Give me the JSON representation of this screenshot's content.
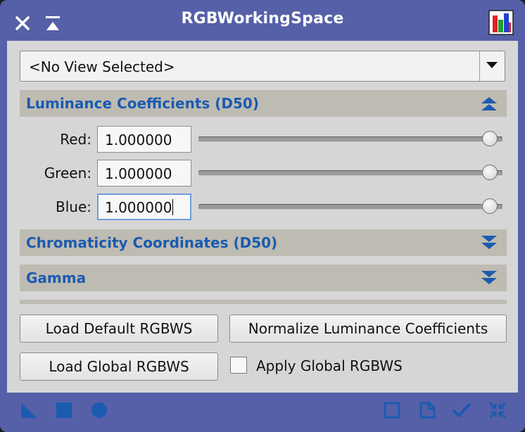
{
  "window": {
    "title": "RGBWorkingSpace"
  },
  "view_selector": {
    "value": "<No View Selected>"
  },
  "sections": {
    "luminance": {
      "title": "Luminance Coefficients (D50)",
      "expanded": true
    },
    "chromaticity": {
      "title": "Chromaticity Coordinates (D50)",
      "expanded": false
    },
    "gamma": {
      "title": "Gamma",
      "expanded": false
    }
  },
  "luminance": {
    "rows": [
      {
        "label": "Red:",
        "value": "1.000000",
        "slider": 1.0
      },
      {
        "label": "Green:",
        "value": "1.000000",
        "slider": 1.0
      },
      {
        "label": "Blue:",
        "value": "1.000000",
        "slider": 1.0
      }
    ]
  },
  "buttons": {
    "load_default": "Load Default RGBWS",
    "normalize": "Normalize Luminance Coefficients",
    "load_global": "Load Global RGBWS"
  },
  "apply_global": {
    "label": "Apply Global RGBWS",
    "checked": false
  },
  "icons": {
    "titlebar": [
      "close-icon",
      "shade-icon",
      "app-icon"
    ],
    "bottom_left": [
      "new-instance-icon",
      "apply-global-icon",
      "apply-icon"
    ],
    "bottom_right": [
      "browse-documentation-icon",
      "edit-instance-icon",
      "apply-check-icon",
      "reset-icon"
    ]
  },
  "colors": {
    "accent": "#1a5bb0",
    "frame": "#5560a8",
    "panel": "#d6d6d6",
    "section": "#bebbb2"
  }
}
